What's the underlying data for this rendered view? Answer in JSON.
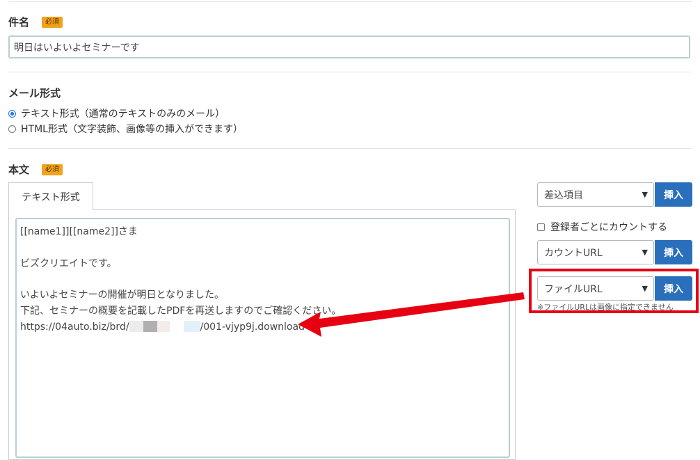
{
  "subject": {
    "label": "件名",
    "required_badge": "必須",
    "value": "明日はいよいよセミナーです"
  },
  "mail_format": {
    "label": "メール形式",
    "options": [
      {
        "label": "テキスト形式（通常のテキストのみのメール）",
        "selected": true
      },
      {
        "label": "HTML形式（文字装飾、画像等の挿入ができます）",
        "selected": false
      }
    ]
  },
  "body": {
    "label": "本文",
    "required_badge": "必須",
    "tab_label": "テキスト形式",
    "lines": [
      "[[name1]][[name2]]さま",
      "",
      "ビズクリエイトです。",
      "",
      "いよいよセミナーの開催が明日となりました。",
      "下記、セミナーの概要を記載したPDFを再送しますのでご確認ください。"
    ],
    "url_prefix": "https://04auto.biz/brd/",
    "url_suffix": "/001-vjyp9j.download"
  },
  "side_panel": {
    "merge_select": "差込項目",
    "count_checkbox_label": "登録者ごとにカウントする",
    "count_select": "カウントURL",
    "file_select": "ファイルURL",
    "insert_label": "挿入",
    "note": "※ファイルURLは画像に指定できません"
  },
  "colors": {
    "badge": "#f0a31a",
    "insert_button": "#2a6fbb",
    "highlight": "#e60012"
  }
}
